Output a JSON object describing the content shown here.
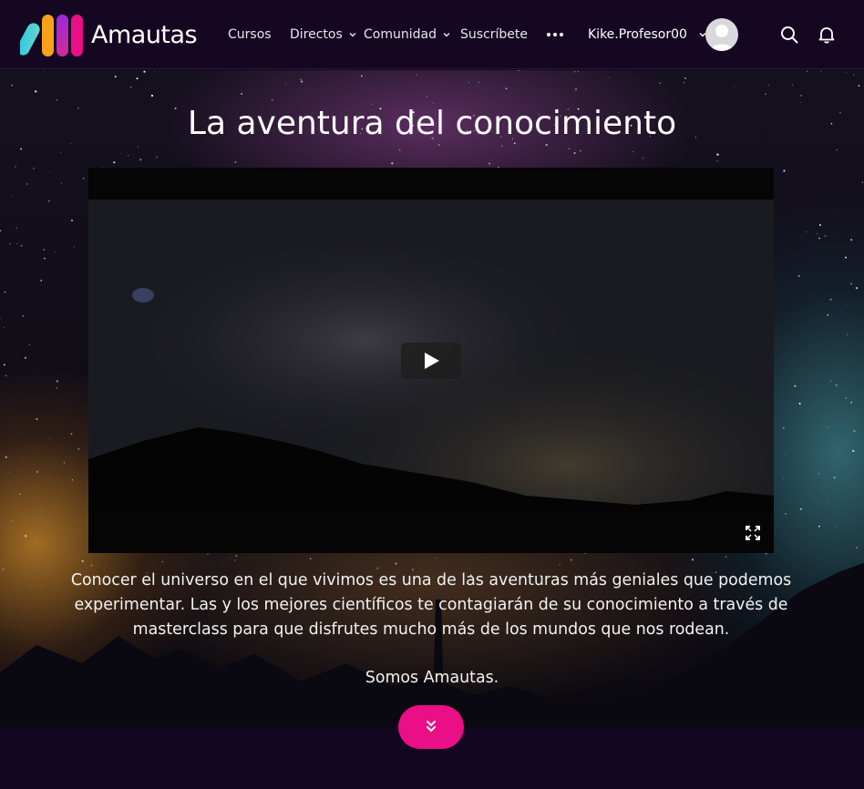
{
  "brand": {
    "name": "Amautas",
    "colors": {
      "cyan": "#19c3e6",
      "orange": "#f7a21b",
      "magenta": "#ea0f86",
      "pink_button": "#ea0f86"
    }
  },
  "nav": {
    "items": [
      {
        "label": "Cursos",
        "has_dropdown": false
      },
      {
        "label": "Directos",
        "has_dropdown": true
      },
      {
        "label": "Comunidad",
        "has_dropdown": true
      },
      {
        "label": "Suscríbete",
        "has_dropdown": false
      }
    ],
    "more_icon": "more-horizontal-icon"
  },
  "user": {
    "name": "Kike.Profesor00",
    "avatar_icon": "avatar-placeholder"
  },
  "header_icons": [
    "search-icon",
    "bell-icon"
  ],
  "hero": {
    "title": "La aventura del conocimiento",
    "description": "Conocer el universo en el que vivimos es una de las aventuras más geniales que podemos experimentar. Las y los mejores científicos te contagiarán de su conocimiento a través de masterclass para que disfrutes mucho más de los mundos que nos rodean.",
    "tagline": "Somos Amautas.",
    "scroll_icon": "double-chevron-down-icon"
  },
  "video": {
    "play_icon": "play-icon",
    "fullscreen_icon": "fullscreen-icon"
  }
}
